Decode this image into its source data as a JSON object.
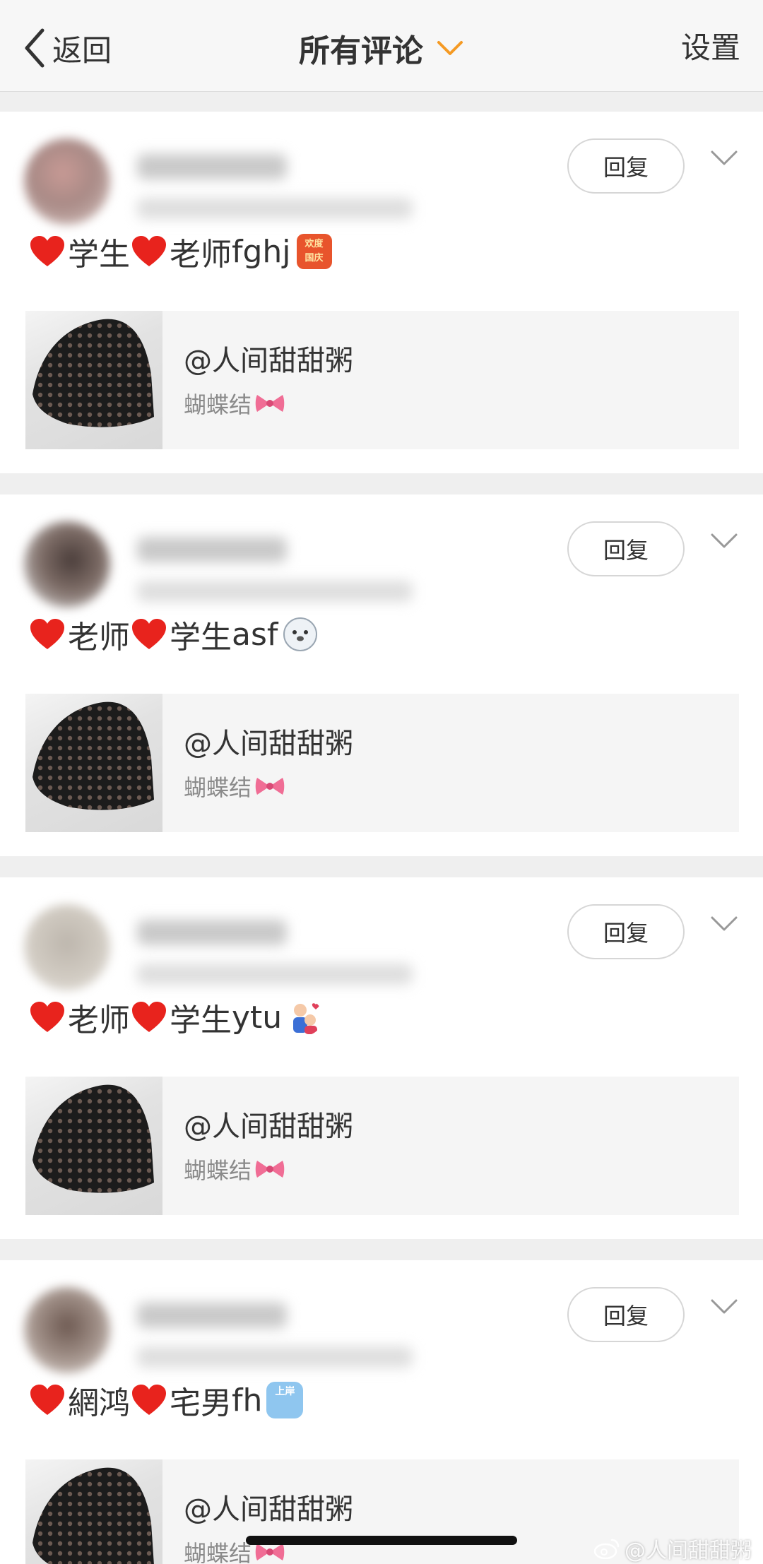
{
  "nav": {
    "back_label": "返回",
    "title": "所有评论",
    "settings_label": "设置",
    "accent_color": "#f59a23"
  },
  "comments": [
    {
      "text_parts": [
        "学生",
        "老师",
        " fghj"
      ],
      "emoji": "欢度国庆",
      "reply_label": "回复",
      "quote_title": "@人间甜甜粥",
      "quote_sub": "蝴蝶结"
    },
    {
      "text_parts": [
        "老师",
        "学生",
        " asf"
      ],
      "emoji": "seal-face",
      "reply_label": "回复",
      "quote_title": "@人间甜甜粥",
      "quote_sub": "蝴蝶结"
    },
    {
      "text_parts": [
        "老师",
        "学生",
        " ytu"
      ],
      "emoji": "couple",
      "reply_label": "回复",
      "quote_title": "@人间甜甜粥",
      "quote_sub": "蝴蝶结"
    },
    {
      "text_parts": [
        "網鸿",
        "宅男",
        " fh"
      ],
      "emoji": "上岸",
      "reply_label": "回复",
      "quote_title": "@人间甜甜粥",
      "quote_sub": "蝴蝶结"
    }
  ],
  "watermark": "@人间甜甜粥"
}
